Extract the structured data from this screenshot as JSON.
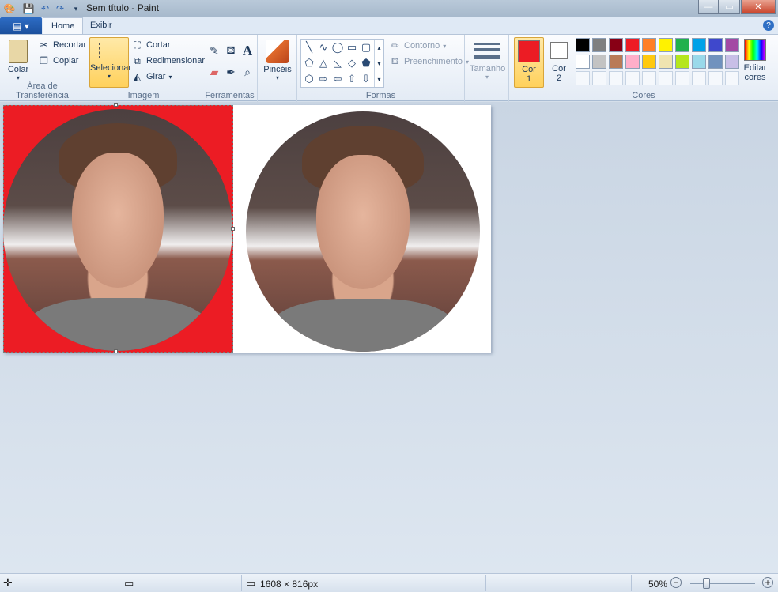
{
  "window": {
    "title": "Sem título - Paint",
    "minimize": "—",
    "maximize": "▭",
    "close": "✕"
  },
  "quick_access": {
    "icons": [
      "paint-app-icon",
      "save-icon",
      "undo-icon",
      "redo-icon",
      "customize-icon"
    ]
  },
  "tabs": {
    "file": "▤ ▾",
    "home": "Home",
    "view": "Exibir",
    "help": "?"
  },
  "clipboard": {
    "paste": "Colar",
    "cut": "Recortar",
    "copy": "Copiar",
    "label": "Área de Transferência"
  },
  "image": {
    "select": "Selecionar",
    "crop": "Cortar",
    "resize": "Redimensionar",
    "rotate": "Girar",
    "label": "Imagem"
  },
  "tools": {
    "label": "Ferramentas",
    "text_tool": "A"
  },
  "brushes": {
    "label": "Pincéis"
  },
  "shapes": {
    "outline": "Contorno",
    "fill": "Preenchimento",
    "label": "Formas"
  },
  "size": {
    "label": "Tamanho"
  },
  "colors": {
    "color1": "Cor",
    "color1_num": "1",
    "color2": "Cor",
    "color2_num": "2",
    "edit": "Editar",
    "edit2": "cores",
    "label": "Cores",
    "color1_value": "#ec1c24",
    "color2_value": "#ffffff",
    "palette_row1": [
      "#000000",
      "#7f7f7f",
      "#880015",
      "#ed1c24",
      "#ff7f27",
      "#fff200",
      "#22b14c",
      "#00a2e8",
      "#3f48cc",
      "#a349a4"
    ],
    "palette_row2": [
      "#ffffff",
      "#c3c3c3",
      "#b97a57",
      "#ffaec9",
      "#ffc90e",
      "#efe4b0",
      "#b5e61d",
      "#99d9ea",
      "#7092be",
      "#c8bfe7"
    ]
  },
  "status": {
    "dimensions": "1608 × 816px",
    "zoom": "50%",
    "zoom_minus": "−",
    "zoom_plus": "+"
  }
}
